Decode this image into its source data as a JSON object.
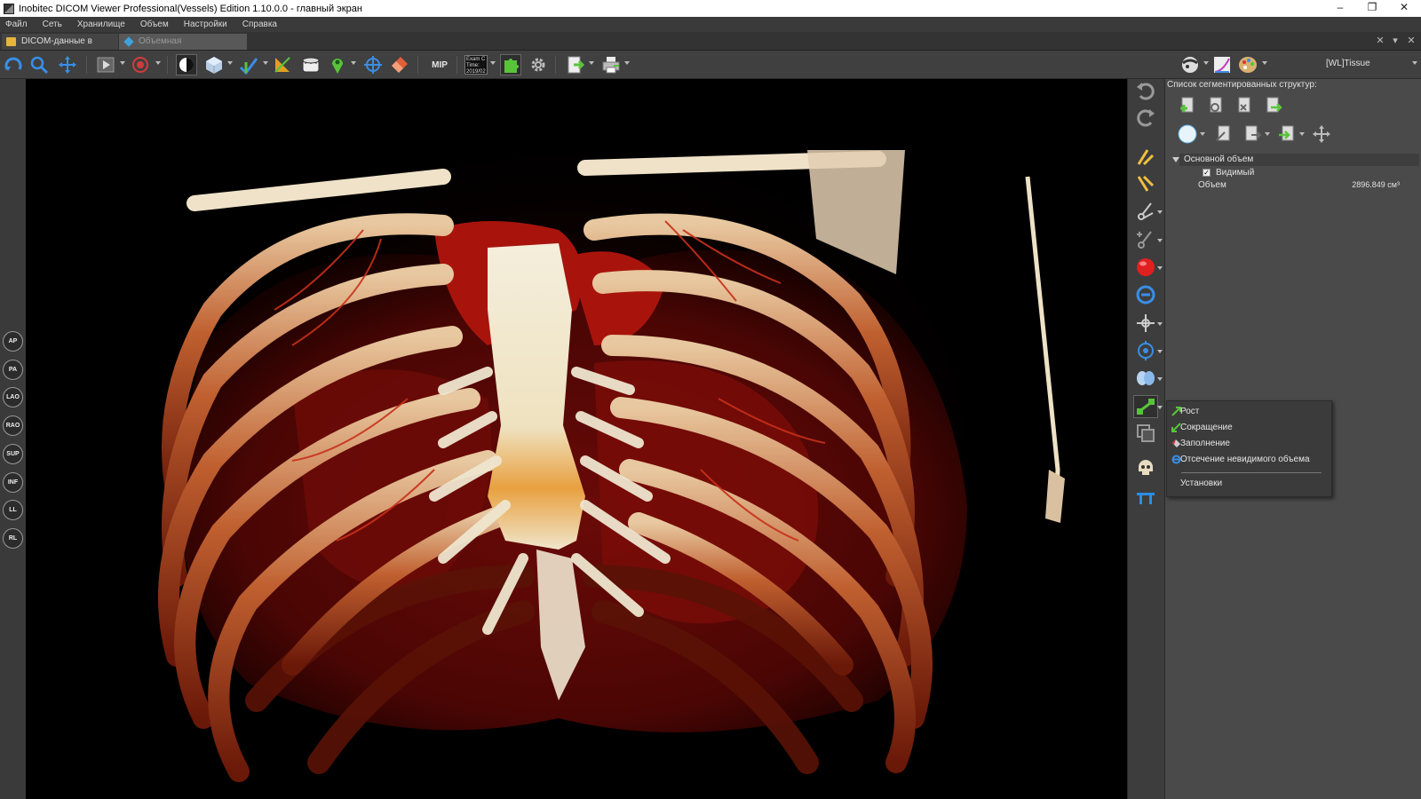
{
  "window": {
    "title": "Inobitec DICOM Viewer Professional(Vessels) Edition 1.10.0.0 - главный экран",
    "controls": {
      "minimize": "–",
      "restore": "❐",
      "close": "✕"
    }
  },
  "menubar": {
    "items": [
      "Файл",
      "Сеть",
      "Хранилище",
      "Объем",
      "Настройки",
      "Справка"
    ]
  },
  "tabs": [
    {
      "label": "DICOM-данные в папке",
      "active": false
    },
    {
      "label": "Объемная реконструкция",
      "active": true
    }
  ],
  "tabbar_controls": {
    "close": "✕",
    "menu": "▾",
    "close_panel": "✕"
  },
  "toolbar": {
    "mip_label": "MIP",
    "examtime_text": "Exam C Time: 2019/02",
    "preset_label": "[WL]Tissue",
    "icons": [
      "rotate-icon",
      "zoom-icon",
      "pan-icon",
      "play-icon",
      "record-icon",
      "contrast-icon",
      "cube-icon",
      "vessel-icon",
      "angle-icon",
      "ruler-icon",
      "pin-icon",
      "crosshair-icon",
      "eraser-icon",
      "examtime-icon",
      "puzzle-icon",
      "settings-icon",
      "export-icon",
      "print-icon",
      "sphere-icon",
      "curve-icon",
      "palette-icon"
    ]
  },
  "orientation_buttons": [
    "AP",
    "PA",
    "LAO",
    "RAO",
    "SUP",
    "INF",
    "LL",
    "RL"
  ],
  "side_tools": [
    "undo-icon",
    "redo-icon",
    "cut-tool-icon",
    "free-cut-icon",
    "scissors-icon",
    "scissors-plus-icon",
    "red-sphere-icon",
    "ring-icon",
    "move-point-icon",
    "target-icon",
    "lungs-icon",
    "branch-icon",
    "copy-layers-icon",
    "skull-icon",
    "table-icon"
  ],
  "panel": {
    "title": "Список сегментированных структур:",
    "tree": {
      "root_label": "Основной объем",
      "visible_label": "Видимый",
      "visible_checked": true,
      "volume_label": "Объем",
      "volume_value": "2896.849 см³"
    }
  },
  "context_menu": {
    "items": [
      {
        "label": "Рост",
        "icon": "grow-icon"
      },
      {
        "label": "Сокращение",
        "icon": "shrink-icon"
      },
      {
        "label": "Заполнение",
        "icon": "fill-icon"
      },
      {
        "label": "Отсечение невидимого объема",
        "icon": "cut-invisible-icon"
      },
      {
        "label": "Установки",
        "icon": ""
      }
    ]
  },
  "colors": {
    "background": "#3c3c3c",
    "viewport": "#000000",
    "accent_blue": "#3a8ee6",
    "accent_green": "#58c43a",
    "bone": "#efe6cf",
    "vessel": "#a8140c"
  }
}
